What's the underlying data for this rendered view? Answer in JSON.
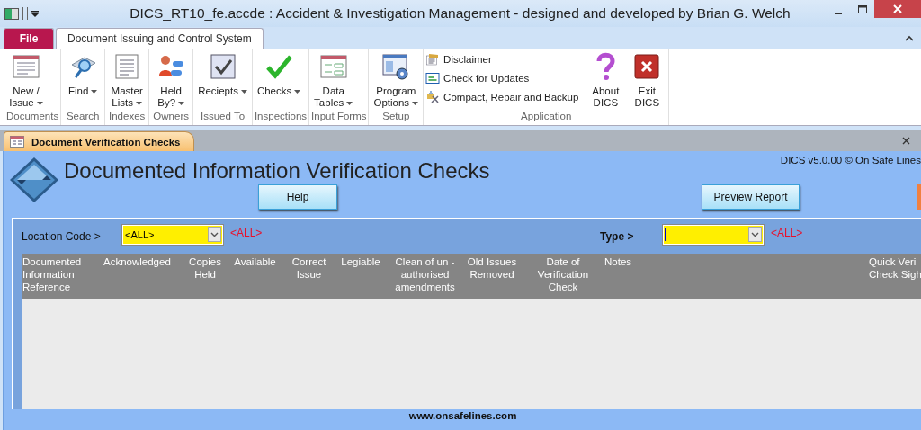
{
  "window": {
    "title": "DICS_RT10_fe.accde : Accident & Investigation Management - designed and developed by Brian G. Welch"
  },
  "ribbon_tabs": [
    {
      "label": "File",
      "kind": "file",
      "selected": false
    },
    {
      "label": "Document Issuing and Control System",
      "kind": "tab",
      "selected": true
    }
  ],
  "ribbon_groups": [
    {
      "label": "Documents",
      "buttons": [
        {
          "kind": "large",
          "label": "New /\nIssue",
          "menu": true
        }
      ]
    },
    {
      "label": "Search",
      "buttons": [
        {
          "kind": "large",
          "label": "Find",
          "menu": true
        }
      ]
    },
    {
      "label": "Indexes",
      "buttons": [
        {
          "kind": "large",
          "label": "Master\nLists",
          "menu": true
        }
      ]
    },
    {
      "label": "Owners",
      "buttons": [
        {
          "kind": "large",
          "label": "Held\nBy?",
          "menu": true
        }
      ]
    },
    {
      "label": "Issued To",
      "buttons": [
        {
          "kind": "large",
          "label": "Reciepts",
          "menu": true
        }
      ]
    },
    {
      "label": "Inspections",
      "buttons": [
        {
          "kind": "large",
          "label": "Checks",
          "menu": true
        }
      ]
    },
    {
      "label": "Input Forms",
      "buttons": [
        {
          "kind": "large",
          "label": "Data\nTables",
          "menu": true
        }
      ]
    },
    {
      "label": "Setup",
      "buttons": [
        {
          "kind": "large",
          "label": "Program\nOptions",
          "menu": true
        }
      ]
    },
    {
      "label": "Application",
      "buttons": [
        {
          "kind": "small",
          "label": "Disclaimer"
        },
        {
          "kind": "small",
          "label": "Check for Updates"
        },
        {
          "kind": "small",
          "label": "Compact, Repair and Backup"
        },
        {
          "kind": "large",
          "label": "About\nDICS",
          "menu": false
        },
        {
          "kind": "large",
          "label": "Exit\nDICS",
          "menu": false
        }
      ]
    }
  ],
  "document_tab": {
    "label": "Document Verification Checks",
    "selected": true
  },
  "form": {
    "title": "Documented Information Verification Checks",
    "version": "DICS v5.0.00 © On Safe Lines",
    "buttons": [
      "Help",
      "Preview Report"
    ],
    "filters": [
      {
        "label": "Location Code >",
        "value": "<ALL>",
        "hint": "<ALL>",
        "focused": false
      },
      {
        "label": "Type >",
        "hint": "<ALL>",
        "focused": true
      }
    ],
    "columns": [
      "Documented\nInformation\nReference",
      "Acknowledged",
      "Copies\nHeld",
      "Available",
      "Correct\nIssue",
      "Legiable",
      "Clean of un -\nauthorised\namendments",
      "Old Issues\nRemoved",
      "Date of\nVerification\nCheck",
      "Notes",
      "Quick Veri\nCheck Sigh"
    ],
    "footer": "www.onsafelines.com"
  }
}
